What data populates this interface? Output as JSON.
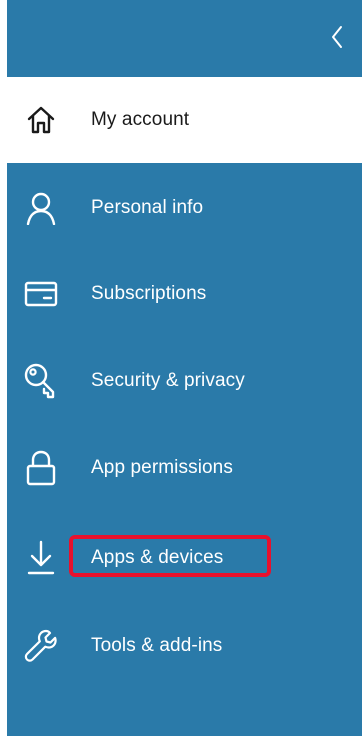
{
  "sidebar": {
    "collapse_icon": "chevron-left-icon",
    "items": [
      {
        "label": "My account",
        "icon": "home-icon",
        "active": true
      },
      {
        "label": "Personal info",
        "icon": "person-icon",
        "active": false
      },
      {
        "label": "Subscriptions",
        "icon": "card-icon",
        "active": false
      },
      {
        "label": "Security & privacy",
        "icon": "key-icon",
        "active": false
      },
      {
        "label": "App permissions",
        "icon": "lock-icon",
        "active": false
      },
      {
        "label": "Apps & devices",
        "icon": "download-icon",
        "active": false,
        "highlighted": true
      },
      {
        "label": "Tools & add-ins",
        "icon": "wrench-icon",
        "active": false
      }
    ]
  },
  "colors": {
    "sidebar_bg": "#2a7aa9",
    "active_bg": "#ffffff",
    "highlight": "#e8112d"
  }
}
